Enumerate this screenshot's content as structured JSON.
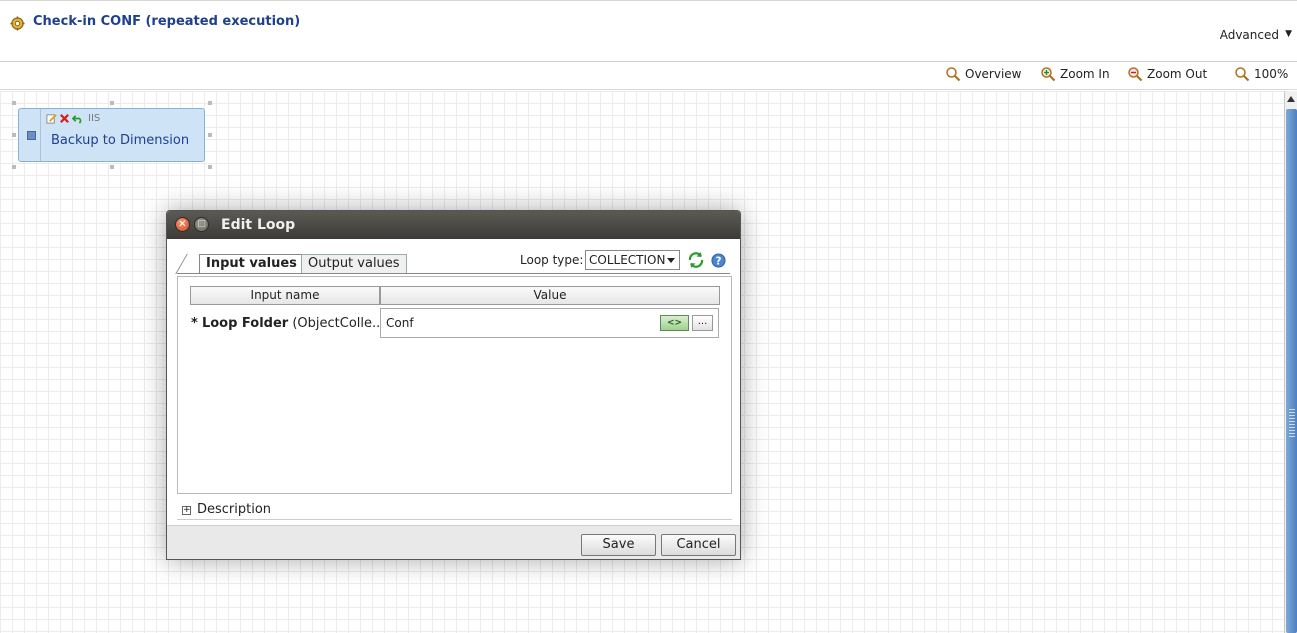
{
  "header": {
    "title": "Check-in CONF (repeated execution)",
    "advanced_label": "Advanced",
    "icon": "gear-icon"
  },
  "toolbar": {
    "overview": "Overview",
    "zoom_in": "Zoom In",
    "zoom_out": "Zoom Out",
    "zoom_level": "100%"
  },
  "node": {
    "label": "Backup to Dimension",
    "tag": "IIS"
  },
  "modal": {
    "title": "Edit Loop",
    "tabs": [
      {
        "label": "Input values",
        "active": true
      },
      {
        "label": "Output values",
        "active": false
      }
    ],
    "loop_type_label": "Loop type:",
    "loop_type_value": "COLLECTION",
    "table": {
      "col_input": "Input name",
      "col_value": "Value",
      "rows": [
        {
          "required": "*",
          "name": "Loop Folder",
          "type": "(ObjectColle...",
          "value": "Conf"
        }
      ]
    },
    "expr_button": "<>",
    "dots_button": "...",
    "description_label": "Description",
    "save_label": "Save",
    "cancel_label": "Cancel"
  },
  "colors": {
    "title_blue": "#1f3f8f",
    "node_bg": "#cfe3f7",
    "modal_title_bg": "#3d3b37"
  }
}
